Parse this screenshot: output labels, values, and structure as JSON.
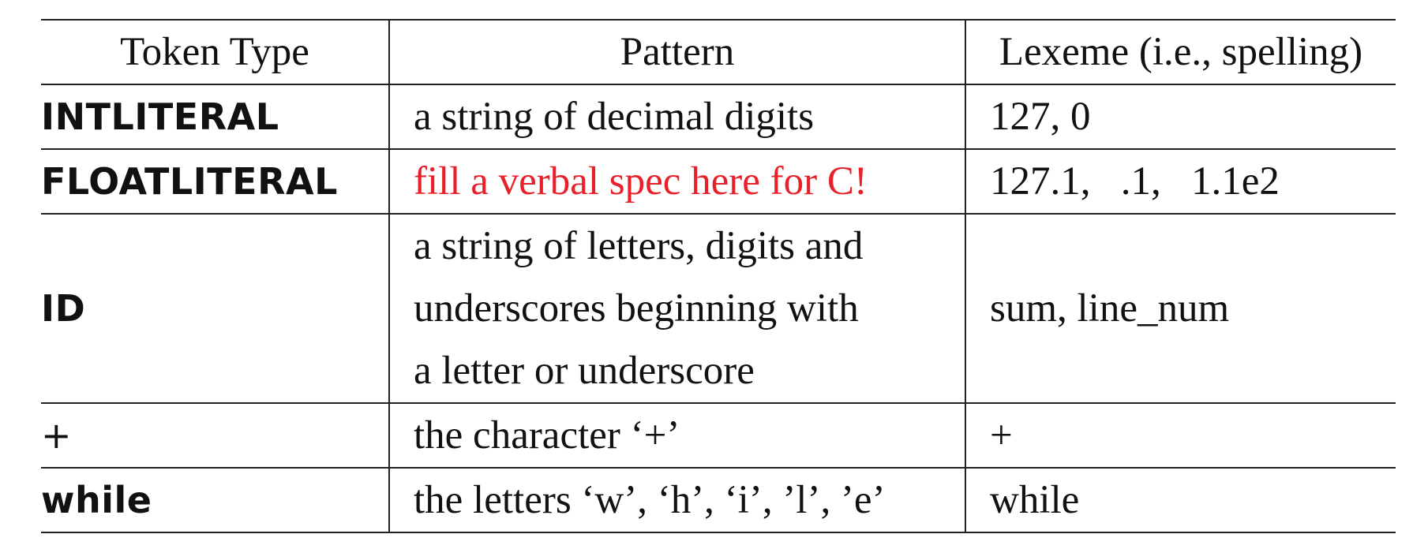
{
  "table": {
    "headers": [
      "Token Type",
      "Pattern",
      "Lexeme (i.e., spelling)"
    ],
    "rows": [
      {
        "token_type": "INTLITERAL",
        "pattern": "a string of decimal digits",
        "lexeme": "127, 0"
      },
      {
        "token_type": "FLOATLITERAL",
        "pattern": "fill a verbal spec here for C!",
        "lexeme": "127.1,   .1,   1.1e2"
      },
      {
        "token_type": "ID",
        "pattern_lines": [
          "a string of letters, digits and",
          "underscores beginning with",
          "a letter or underscore"
        ],
        "lexeme": "sum, line_num"
      },
      {
        "token_type": "+",
        "pattern": "the character ‘+’",
        "lexeme": "+"
      },
      {
        "token_type": "while",
        "pattern": "the letters ‘w’, ‘h’, ‘i’, ’l’, ’e’",
        "lexeme": "while"
      }
    ]
  },
  "colors": {
    "text": "#111111",
    "highlight": "#e8202a",
    "rule": "#222222"
  }
}
